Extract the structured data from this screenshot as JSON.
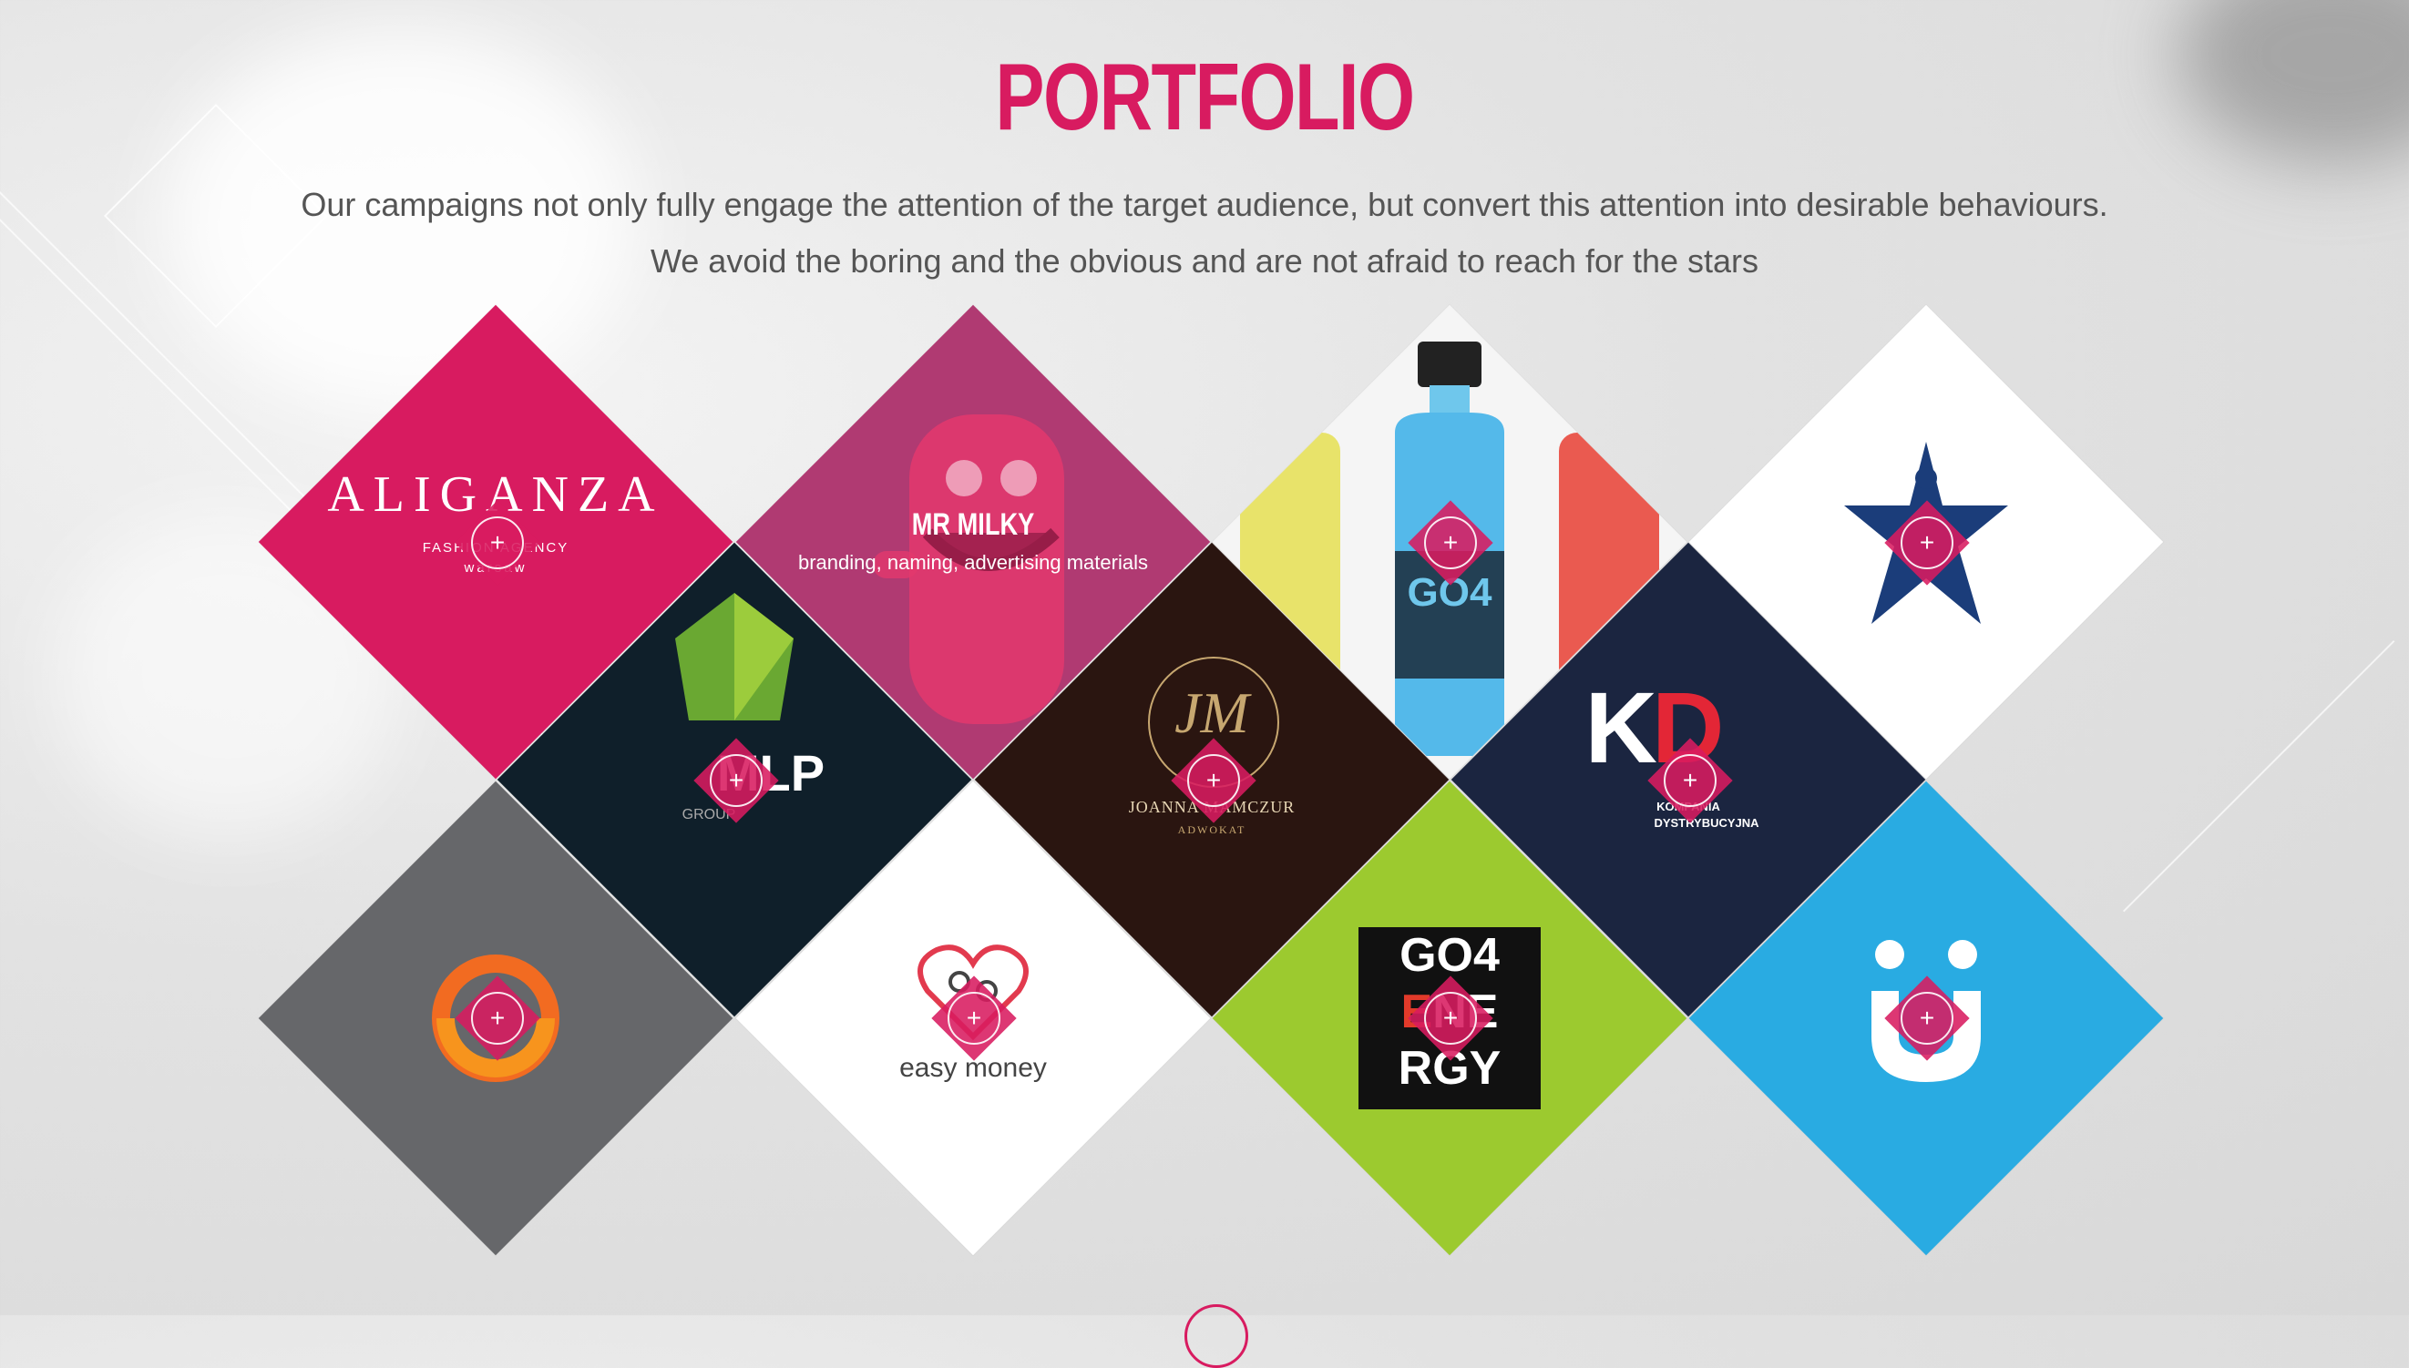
{
  "header": {
    "title": "PORTFOLIO",
    "subtitle_line1": "Our campaigns not only fully engage the attention of the target audience, but convert this attention into desirable behaviours.",
    "subtitle_line2": "We avoid the boring and the obvious and are not afraid to reach for the stars"
  },
  "colors": {
    "accent": "#d81b60",
    "aliganza_bg": "#d81b60",
    "mrmilky_bg": "#b03a72",
    "dark_navy": "#0f1f2a",
    "dark_brown": "#2a1510",
    "kd_bg": "#1b2540",
    "grey_bg": "#66676a",
    "lime_bg": "#9cca2f",
    "blue_bg": "#29abe2",
    "white_bg": "#ffffff"
  },
  "portfolio": {
    "aliganza": {
      "logo": "ALIGANZA",
      "tagline": "FASHION AGENCY",
      "city": "warsaw"
    },
    "mr_milky": {
      "title": "MR MILKY",
      "caption": "branding, naming, advertising materials"
    },
    "go4energy_bottle": {
      "label": "GO4",
      "icon": "sport-drink-bottle"
    },
    "star_logo": {
      "icon": "blue-star-figure"
    },
    "mlp": {
      "logo": "MLP",
      "sub": "GROUP"
    },
    "joanna": {
      "monogram": "JM",
      "name": "JOANNA MAMCZUR",
      "role": "ADWOKAT"
    },
    "kd": {
      "logo": "KD",
      "line1": "KOMPANIA",
      "line2": "DYSTRYBUCYJNA"
    },
    "orange_swirl": {
      "icon": "orange-swirl-logo"
    },
    "easy_money": {
      "logo": "easy money"
    },
    "go4energy": {
      "row1": [
        "G",
        "O",
        "4"
      ],
      "row2": [
        "E",
        "N",
        "E"
      ],
      "row3": [
        "R",
        "G",
        "Y"
      ]
    },
    "smile": {
      "icon": "smile-logo"
    },
    "badge_symbol": "+"
  }
}
